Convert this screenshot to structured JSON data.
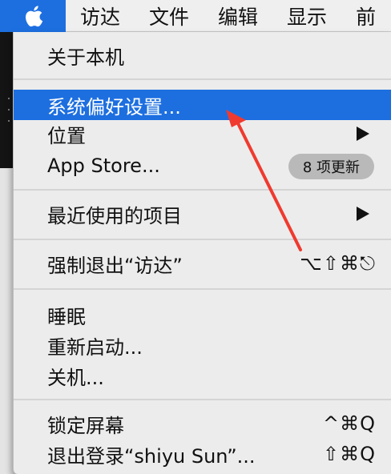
{
  "menubar": {
    "items": [
      "访达",
      "文件",
      "编辑",
      "显示",
      "前"
    ]
  },
  "menu": {
    "about": "关于本机",
    "system_prefs": "系统偏好设置...",
    "location": "位置",
    "app_store": "App Store...",
    "app_store_badge": "8 项更新",
    "recent_items": "最近使用的项目",
    "force_quit": "强制退出“访达”",
    "force_quit_shortcut": "⌥⇧⌘⎋",
    "sleep": "睡眠",
    "restart": "重新启动...",
    "shutdown": "关机...",
    "lock_screen": "锁定屏幕",
    "lock_screen_shortcut": "^⌘Q",
    "logout": "退出登录“shiyu Sun”...",
    "logout_shortcut": "⇧⌘Q"
  },
  "colors": {
    "highlight": "#1d6fe0",
    "annotation_arrow": "#f03a2f"
  },
  "icons": [
    "apple-icon",
    "submenu-arrow-icon"
  ]
}
